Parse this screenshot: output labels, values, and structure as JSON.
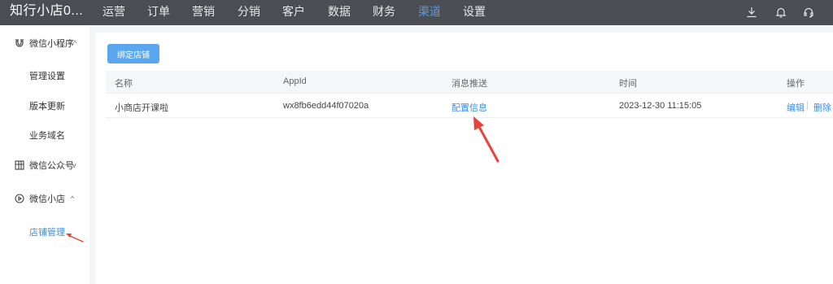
{
  "topbar": {
    "brand": "知行小店0...",
    "nav": [
      "运营",
      "订单",
      "营销",
      "分销",
      "客户",
      "数据",
      "财务",
      "渠道",
      "设置"
    ],
    "active_nav": "渠道",
    "icons": [
      "download-icon",
      "bell-icon",
      "headset-icon"
    ]
  },
  "sidebar": {
    "groups": [
      {
        "label": "微信小程序",
        "icon": "magnet-icon",
        "chevron": "^",
        "items": [
          "管理设置",
          "版本更新",
          "业务域名"
        ]
      },
      {
        "label": "微信公众号",
        "icon": "grid-icon",
        "chevron": "v",
        "items": []
      },
      {
        "label": "微信小店",
        "icon": "play-circle-icon",
        "chevron": "^",
        "items": [
          "店铺管理"
        ]
      }
    ],
    "active_item": "店铺管理"
  },
  "main": {
    "bind_button": "绑定店铺",
    "table": {
      "headers": [
        "名称",
        "AppId",
        "消息推送",
        "时间",
        "操作"
      ],
      "rows": [
        {
          "name": "小商店开课啦",
          "appid": "wx8fb6edd44f07020a",
          "push": "配置信息",
          "time": "2023-12-30 11:15:05",
          "edit": "编辑",
          "delete": "删除"
        }
      ]
    }
  },
  "colors": {
    "topbar": "#4a4d52",
    "accent": "#3a8ee6",
    "button": "#5aa7f0",
    "annotation_arrow": "#e8433a"
  }
}
